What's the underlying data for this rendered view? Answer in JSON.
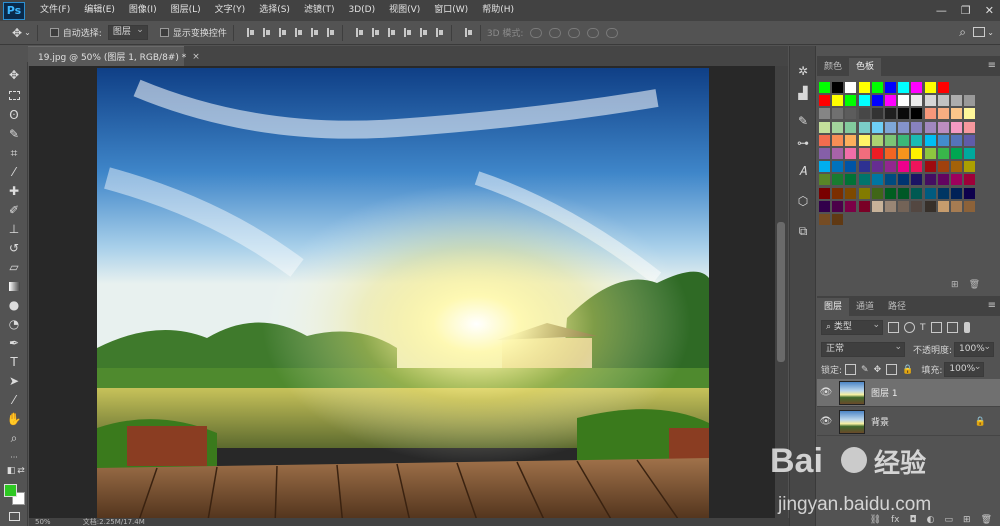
{
  "app": {
    "logo": "Ps"
  },
  "menu": [
    "文件(F)",
    "编辑(E)",
    "图像(I)",
    "图层(L)",
    "文字(Y)",
    "选择(S)",
    "滤镜(T)",
    "3D(D)",
    "视图(V)",
    "窗口(W)",
    "帮助(H)"
  ],
  "window_controls": {
    "minimize": "—",
    "restore": "❐",
    "close": "✕"
  },
  "options": {
    "auto_select_label": "自动选择:",
    "auto_select_value": "图层",
    "show_transform_label": "显示变换控件",
    "mode_3d_label": "3D 模式:"
  },
  "document": {
    "tab_title": "19.jpg @ 50% (图层 1, RGB/8#) *",
    "tab_close": "×"
  },
  "status": {
    "zoom": "50%",
    "info": "文档:2.25M/17.4M"
  },
  "colors": {
    "foreground": "#2ec823",
    "background": "#ffffff"
  },
  "swatch_panel": {
    "tabs": [
      "颜色",
      "色板"
    ],
    "active": "色板"
  },
  "layers_panel": {
    "tabs": [
      "图层",
      "通道",
      "路径"
    ],
    "active": "图层",
    "filter_kind": "类型",
    "blend_mode": "正常",
    "opacity_label": "不透明度:",
    "opacity_value": "100%",
    "lock_label": "锁定:",
    "fill_label": "填充:",
    "fill_value": "100%",
    "layers": [
      {
        "name": "图层 1",
        "selected": true,
        "locked": false
      },
      {
        "name": "背景",
        "selected": false,
        "locked": true
      }
    ]
  },
  "watermark": {
    "brand": "Bai",
    "brand2": "经验",
    "url": "jingyan.baidu.com"
  },
  "swatches": [
    [
      "#00ff00",
      "#000000",
      "#ffffff",
      "#ffff00",
      "#00ff00",
      "#0000ff",
      "#00ffff",
      "#ff00ff",
      "#ffff00",
      "#ff0000"
    ],
    [
      "#ff0000",
      "#ffff00",
      "#00ff00",
      "#00ffff",
      "#0000ff",
      "#ff00ff",
      "#ffffff",
      "#ebebeb",
      "#d6d6d6",
      "#c2c2c2",
      "#adadad",
      "#999999"
    ],
    [
      "#858585",
      "#707070",
      "#5c5c5c",
      "#474747",
      "#333333",
      "#1f1f1f",
      "#0a0a0a",
      "#000000",
      "#f7977a",
      "#f9ad81",
      "#fdc68a",
      "#fff79a"
    ],
    [
      "#c4df9b",
      "#a2d39c",
      "#82ca9d",
      "#7bcdc8",
      "#6ecff6",
      "#7ea7d8",
      "#8493ca",
      "#8882be",
      "#a187be",
      "#bc8dbf",
      "#f49ac2",
      "#f6989d"
    ],
    [
      "#f26c4f",
      "#f68e55",
      "#fbaf5c",
      "#fff467",
      "#acd372",
      "#7cc576",
      "#3bb878",
      "#1abbb4",
      "#00bff3",
      "#438ccb",
      "#5574b9",
      "#605ca8"
    ],
    [
      "#855fa8",
      "#a763a8",
      "#f06ea9",
      "#f26d7d",
      "#ed1c24",
      "#f26522",
      "#f7941d",
      "#fff200",
      "#8dc63f",
      "#39b54a",
      "#00a651",
      "#00a99d"
    ],
    [
      "#00aeef",
      "#0072bc",
      "#0054a6",
      "#2e3192",
      "#662d91",
      "#92278f",
      "#ec008c",
      "#ed145b",
      "#9e0b0f",
      "#a0410d",
      "#a36209",
      "#aba000"
    ],
    [
      "#598527",
      "#197b30",
      "#007236",
      "#00746b",
      "#0076a3",
      "#004b80",
      "#003471",
      "#1b1464",
      "#440e62",
      "#630460",
      "#9e005d",
      "#9e0039"
    ],
    [
      "#790000",
      "#7b2e00",
      "#7d4900",
      "#827b00",
      "#406618",
      "#005e20",
      "#005826",
      "#005952",
      "#005b7f",
      "#003663",
      "#002157",
      "#0d004c"
    ],
    [
      "#32004b",
      "#4b0049",
      "#7b0046",
      "#7a0026",
      "#c7b299",
      "#998675",
      "#736357",
      "#534741",
      "#37302a",
      "#c69c6d",
      "#a67c52",
      "#8c6239"
    ],
    [
      "#754c24",
      "#603913"
    ]
  ]
}
